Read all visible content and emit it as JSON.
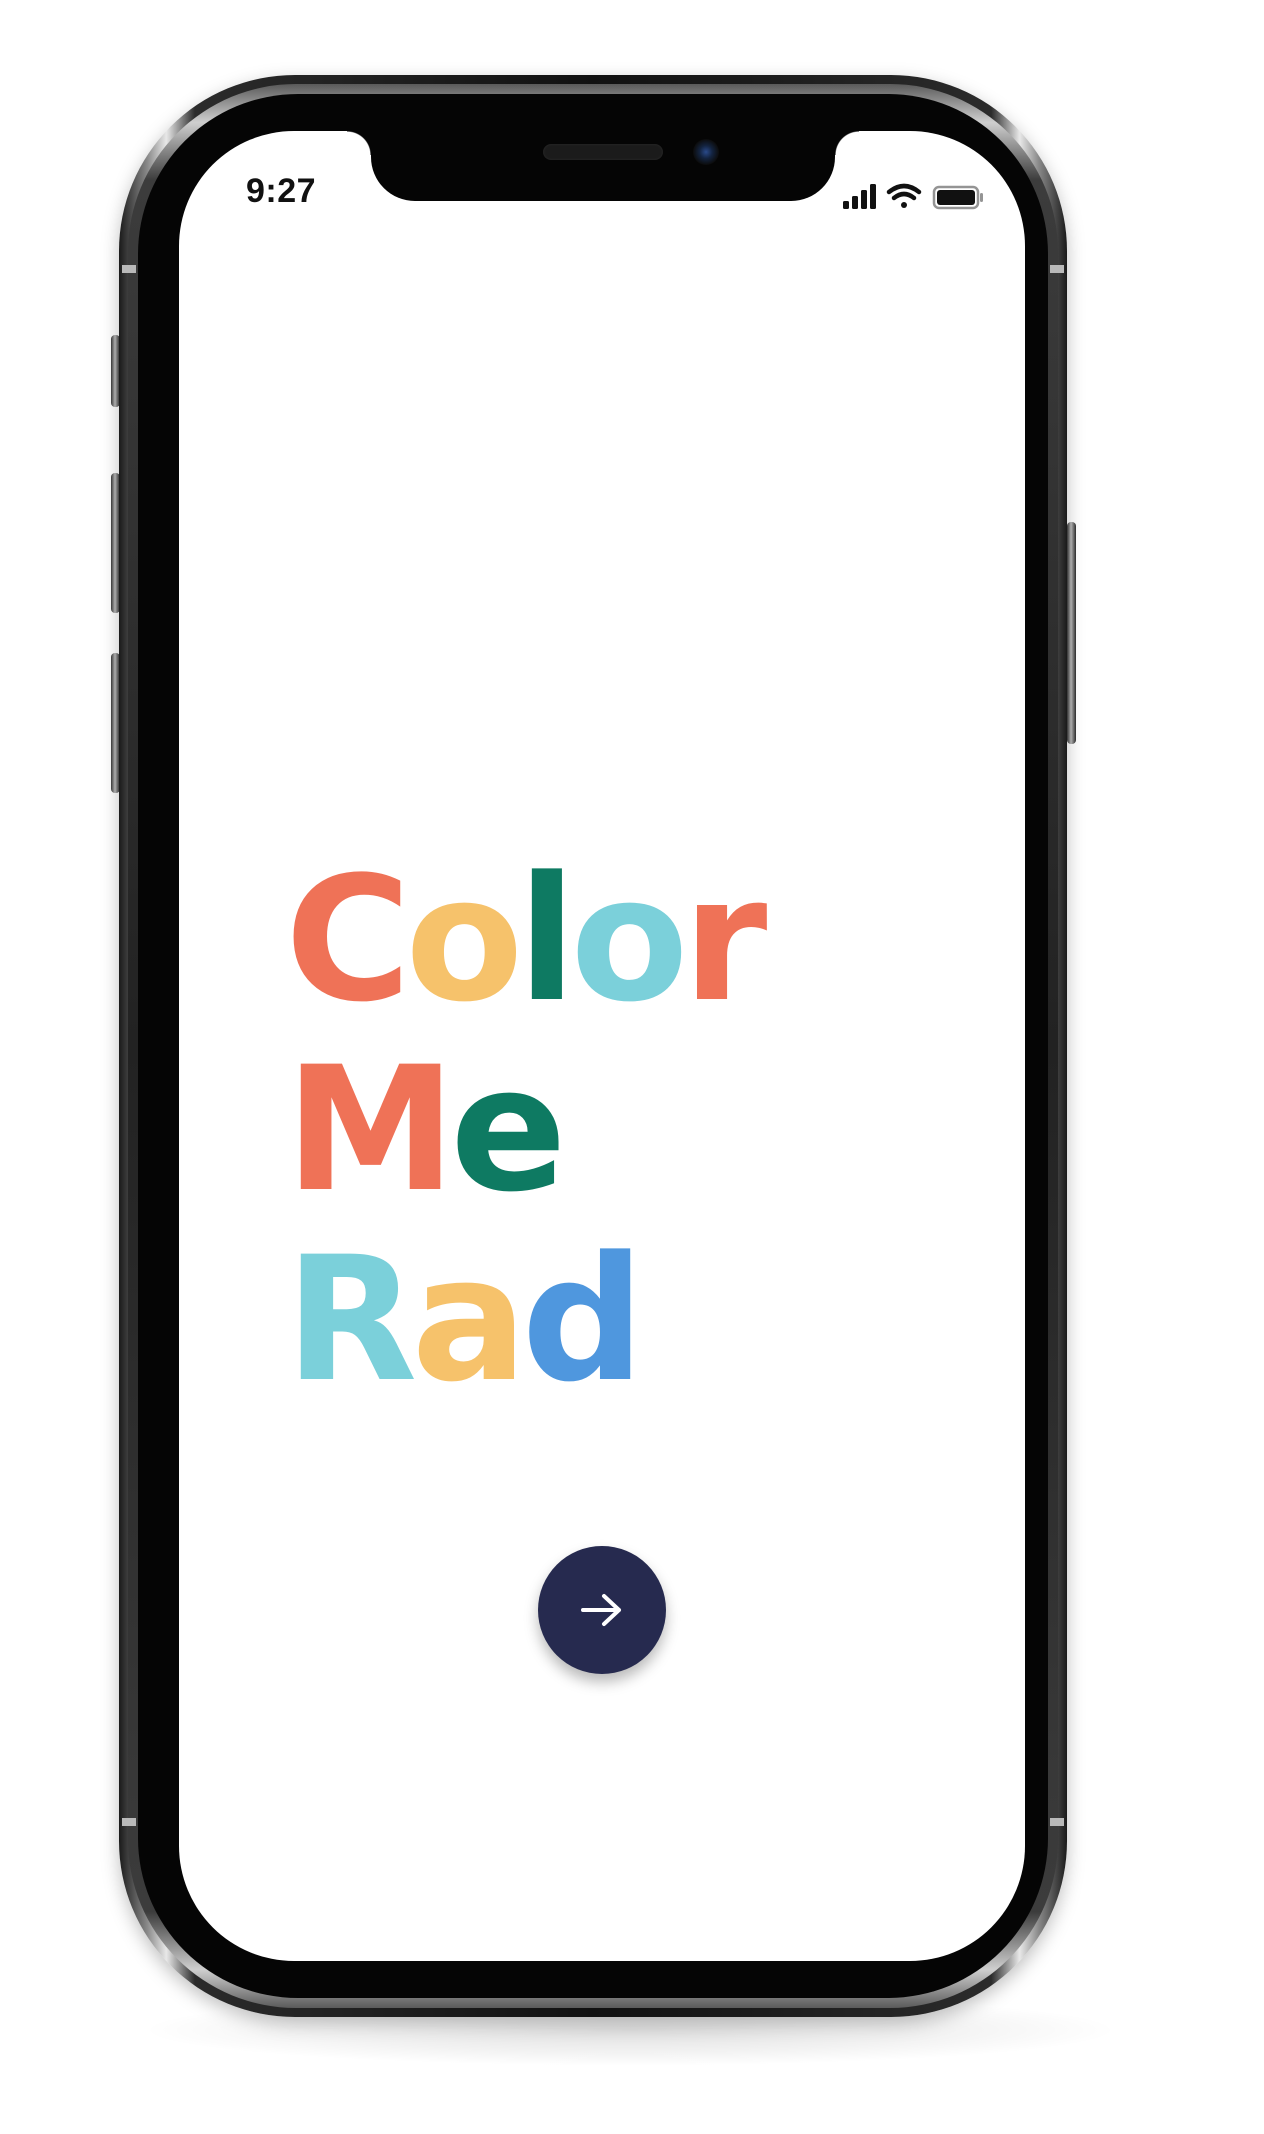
{
  "status_bar": {
    "time": "9:27",
    "icons": [
      "cellular-signal-icon",
      "wifi-icon",
      "battery-icon"
    ]
  },
  "logo": {
    "lines": [
      {
        "letters": [
          {
            "char": "C",
            "color": "#ef7257"
          },
          {
            "char": "o",
            "color": "#f6c26b"
          },
          {
            "char": "l",
            "color": "#0e7a62"
          },
          {
            "char": "o",
            "color": "#7bd0da"
          },
          {
            "char": "r",
            "color": "#ef7257"
          }
        ]
      },
      {
        "letters": [
          {
            "char": "M",
            "color": "#ef7257"
          },
          {
            "char": "e",
            "color": "#0e7a62"
          }
        ]
      },
      {
        "letters": [
          {
            "char": "R",
            "color": "#7bd0da"
          },
          {
            "char": "a",
            "color": "#f6c26b"
          },
          {
            "char": "d",
            "color": "#4f97de"
          }
        ]
      }
    ]
  },
  "next_button": {
    "icon": "arrow-right-icon",
    "background": "#262a4f",
    "icon_color": "#ffffff"
  }
}
